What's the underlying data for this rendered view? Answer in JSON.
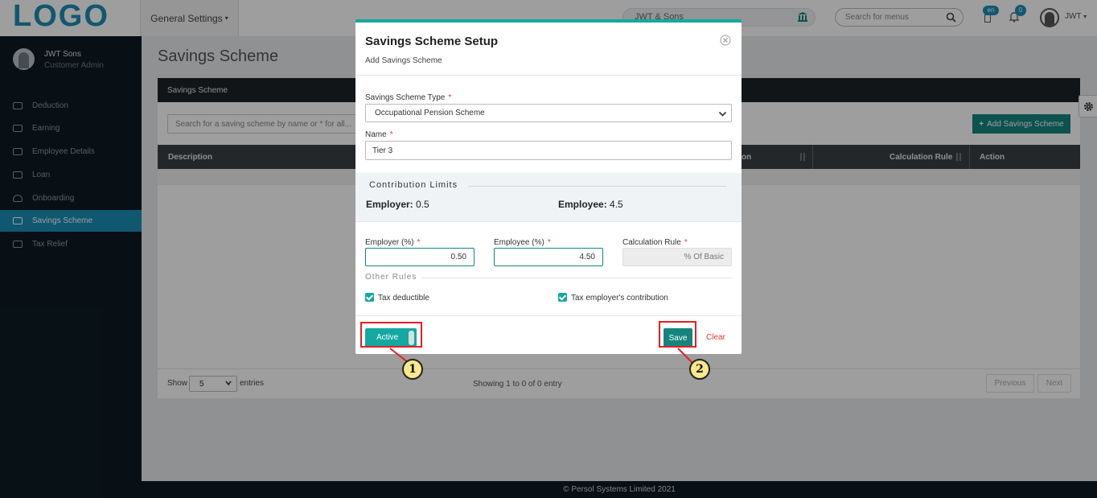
{
  "header": {
    "logo": "LOGO",
    "general_settings": "General Settings",
    "org_name": "JWT & Sons",
    "search_placeholder": "Search for menus",
    "lang": "en",
    "notif_count": "0",
    "user": "JWT"
  },
  "sidebar": {
    "user_name": "JWT Sons",
    "user_role": "Customer Admin",
    "items": [
      {
        "label": "Deduction",
        "icon": "deduction-icon"
      },
      {
        "label": "Earning",
        "icon": "earning-icon"
      },
      {
        "label": "Employee Details",
        "icon": "employee-card-icon"
      },
      {
        "label": "Loan",
        "icon": "loan-icon"
      },
      {
        "label": "Onboarding",
        "icon": "cloud-upload-icon"
      },
      {
        "label": "Savings Scheme",
        "icon": "savings-icon",
        "active": true
      },
      {
        "label": "Tax Relief",
        "icon": "tax-icon"
      }
    ]
  },
  "main": {
    "page_title": "Savings Scheme",
    "panel_title": "Savings Scheme",
    "search_placeholder": "Search for a saving scheme by name or * for all...",
    "add_button": "Add Savings Scheme",
    "columns": [
      "Description",
      "on",
      "Calculation Rule",
      "Action"
    ],
    "show_label": "Show",
    "page_size": "5",
    "entries_label": "entries",
    "showing": "Showing 1 to 0 of 0 entry",
    "prev": "Previous",
    "next": "Next"
  },
  "modal": {
    "title": "Savings Scheme Setup",
    "subtitle": "Add Savings Scheme",
    "type_label": "Savings Scheme Type",
    "type_value": "Occupational Pension Scheme",
    "name_label": "Name",
    "name_value": "Tier 3",
    "limits_title": "Contribution Limits",
    "employer_limit_label": "Employer:",
    "employer_limit_value": "0.5",
    "employee_limit_label": "Employee:",
    "employee_limit_value": "4.5",
    "employer_pct_label": "Employer (%)",
    "employer_pct_value": "0.50",
    "employee_pct_label": "Employee (%)",
    "employee_pct_value": "4.50",
    "calc_rule_label": "Calculation Rule",
    "calc_rule_value": "% Of Basic",
    "other_rules": "Other Rules",
    "tax_deductible": "Tax deductible",
    "tax_employer": "Tax employer's contribution",
    "active_label": "Active",
    "save_label": "Save",
    "clear_label": "Clear",
    "required_mark": "*"
  },
  "footer": {
    "copyright": "© Persol Systems Limited 2021"
  },
  "annotations": [
    "1",
    "2"
  ],
  "colors": {
    "accent": "#14a8a0",
    "brand": "#1a8fb5",
    "highlight": "#e31e24",
    "sidebar_bg": "#0d1b22"
  }
}
